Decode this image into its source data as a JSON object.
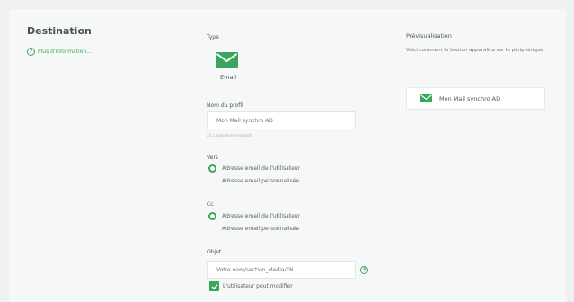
{
  "destination": {
    "title": "Destination",
    "more_info": "Plus d'information..."
  },
  "form": {
    "type_label": "Type",
    "type_value": "Email",
    "type_icon": "envelope-icon",
    "profile_name_label": "Nom du profil",
    "profile_name_value": "Mon Mail synchro AD",
    "chars_remaining": "21 caractères restants",
    "to_label": "Vers",
    "to_options": [
      {
        "label": "Adresse email de l'utilisateur",
        "selected": true
      },
      {
        "label": "Adresse email personnalisée",
        "selected": false
      }
    ],
    "cc_label": "Cc",
    "cc_options": [
      {
        "label": "Adresse email de l'utilisateur",
        "selected": true
      },
      {
        "label": "Adresse email personnalisée",
        "selected": false
      }
    ],
    "subject_label": "Objet",
    "subject_value": "Votre nom/section_Media/FN",
    "user_can_modify_label": "L'utilisateur peut modifier",
    "user_can_modify_checked": true
  },
  "preview": {
    "title": "Prévisualisation",
    "description": "Voici comment le bouton apparaîtra sur le périphérique",
    "button_label": "Mon Mail synchro AD",
    "button_icon": "envelope-icon"
  },
  "colors": {
    "accent": "#3aa55f",
    "page_background": "#eef0f1",
    "panel_background": "#f6f7f7"
  }
}
